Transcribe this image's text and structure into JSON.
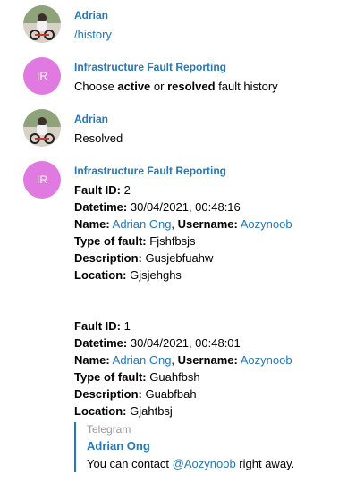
{
  "messages": [
    {
      "sender": "Adrian",
      "avatar": "photo",
      "text": "/history"
    },
    {
      "sender": "Infrastructure Fault Reporting",
      "avatar": "IR",
      "text_pre": "Choose ",
      "bold1": "active",
      "text_mid": " or ",
      "bold2": "resolved",
      "text_post": " fault history"
    },
    {
      "sender": "Adrian",
      "avatar": "photo",
      "text": "Resolved"
    },
    {
      "sender": "Infrastructure Fault Reporting",
      "avatar": "IR"
    }
  ],
  "labels": {
    "fault_id": "Fault ID:",
    "datetime": "Datetime:",
    "name": "Name:",
    "username": "Username:",
    "type": "Type of fault:",
    "description": "Description:",
    "location": "Location:"
  },
  "faults": [
    {
      "id": "2",
      "datetime": "30/04/2021, 00:48:16",
      "name": "Adrian Ong",
      "username": "Aozynoob",
      "type": "Fjshfbsjs",
      "description": "Gusjebfuahw",
      "location": "Gjsjehghs"
    },
    {
      "id": "1",
      "datetime": "30/04/2021, 00:48:01",
      "name": "Adrian Ong",
      "username": "Aozynoob",
      "type": "Guahfbsh",
      "description": "Guabfbah",
      "location": "Gjahtbsj"
    }
  ],
  "quote": {
    "title": "Telegram",
    "sender": "Adrian Ong",
    "text_pre": "You can contact ",
    "mention": "@Aozynoob",
    "text_post": " right away."
  },
  "colors": {
    "link": "#2678b6",
    "avatar_ir": "#e07ae0"
  }
}
